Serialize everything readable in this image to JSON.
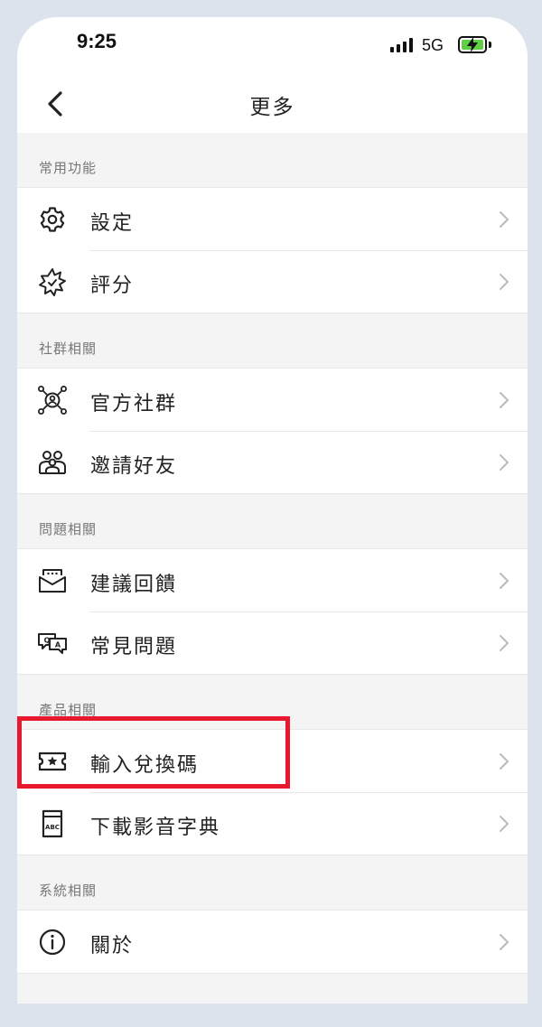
{
  "status_bar": {
    "time": "9:25",
    "network": "5G",
    "battery_color": "#5fd045"
  },
  "nav": {
    "title": "更多",
    "back_icon": "chevron-left-icon"
  },
  "sections": [
    {
      "header": "常用功能",
      "items": [
        {
          "label": "設定",
          "icon": "gear-icon"
        },
        {
          "label": "評分",
          "icon": "star-burst-icon"
        }
      ]
    },
    {
      "header": "社群相關",
      "items": [
        {
          "label": "官方社群",
          "icon": "community-network-icon"
        },
        {
          "label": "邀請好友",
          "icon": "friends-group-icon"
        }
      ]
    },
    {
      "header": "問題相關",
      "items": [
        {
          "label": "建議回饋",
          "icon": "feedback-message-icon"
        },
        {
          "label": "常見問題",
          "icon": "faq-chat-icon"
        }
      ]
    },
    {
      "header": "產品相關",
      "items": [
        {
          "label": "輸入兌換碼",
          "icon": "ticket-star-icon"
        },
        {
          "label": "下載影音字典",
          "icon": "abc-book-icon"
        }
      ]
    },
    {
      "header": "系統相關",
      "items": [
        {
          "label": "關於",
          "icon": "info-icon"
        }
      ]
    }
  ],
  "highlight": {
    "target": "輸入兌換碼",
    "color": "#e8192c"
  }
}
